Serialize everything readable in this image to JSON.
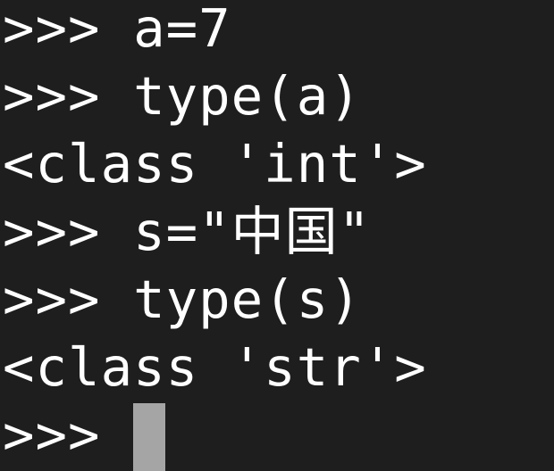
{
  "terminal": {
    "lines": [
      {
        "type": "input",
        "prompt": ">>>",
        "text": " a=7"
      },
      {
        "type": "input",
        "prompt": ">>>",
        "text": " type(a)"
      },
      {
        "type": "output",
        "text": "<class 'int'>"
      },
      {
        "type": "input",
        "prompt": ">>>",
        "text": " s=\"中国\""
      },
      {
        "type": "input",
        "prompt": ">>>",
        "text": " type(s)"
      },
      {
        "type": "output",
        "text": "<class 'str'>"
      },
      {
        "type": "input",
        "prompt": ">>>",
        "text": " "
      }
    ],
    "colors": {
      "background": "#1e1e1e",
      "text": "#ffffff",
      "cursor": "#a5a5a5"
    }
  }
}
